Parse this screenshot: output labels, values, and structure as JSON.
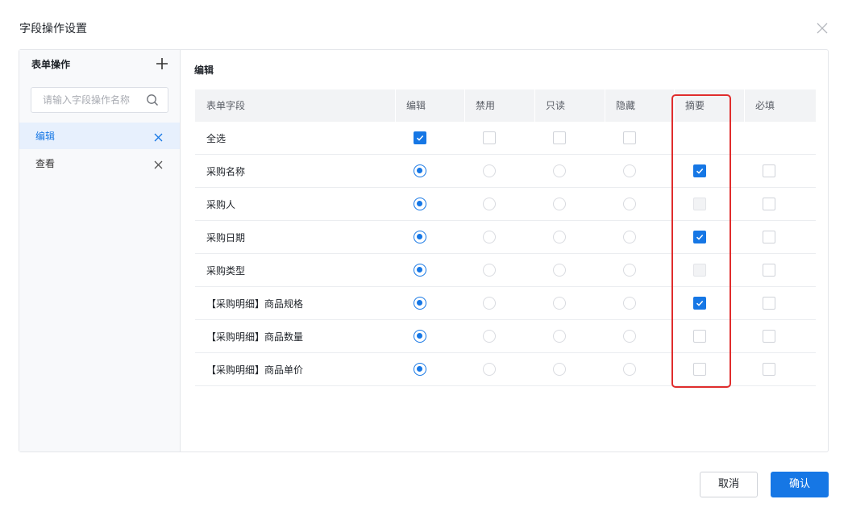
{
  "dialog": {
    "title": "字段操作设置",
    "cancel_label": "取消",
    "ok_label": "确认",
    "accent_color": "#1677e5",
    "highlight_color": "#e02d2d"
  },
  "sidebar": {
    "header": "表单操作",
    "search_placeholder": "请输入字段操作名称",
    "items": [
      {
        "label": "编辑",
        "active": true
      },
      {
        "label": "查看",
        "active": false
      }
    ]
  },
  "main": {
    "title": "编辑",
    "columns": [
      "表单字段",
      "编辑",
      "禁用",
      "只读",
      "隐藏",
      "摘要",
      "必填"
    ],
    "select_all": {
      "label": "全选",
      "edit": true,
      "disabled": false,
      "readonly": false,
      "hidden": false
    },
    "rows": [
      {
        "label": "采购名称",
        "mode": "edit",
        "summary": "checked",
        "required": false
      },
      {
        "label": "采购人",
        "mode": "edit",
        "summary": "disabled",
        "required": false
      },
      {
        "label": "采购日期",
        "mode": "edit",
        "summary": "checked",
        "required": false
      },
      {
        "label": "采购类型",
        "mode": "edit",
        "summary": "disabled",
        "required": false
      },
      {
        "label": "【采购明细】商品规格",
        "mode": "edit",
        "summary": "checked",
        "required": false
      },
      {
        "label": "【采购明细】商品数量",
        "mode": "edit",
        "summary": "unchecked",
        "required": false
      },
      {
        "label": "【采购明细】商品单价",
        "mode": "edit",
        "summary": "unchecked",
        "required": false
      }
    ]
  }
}
